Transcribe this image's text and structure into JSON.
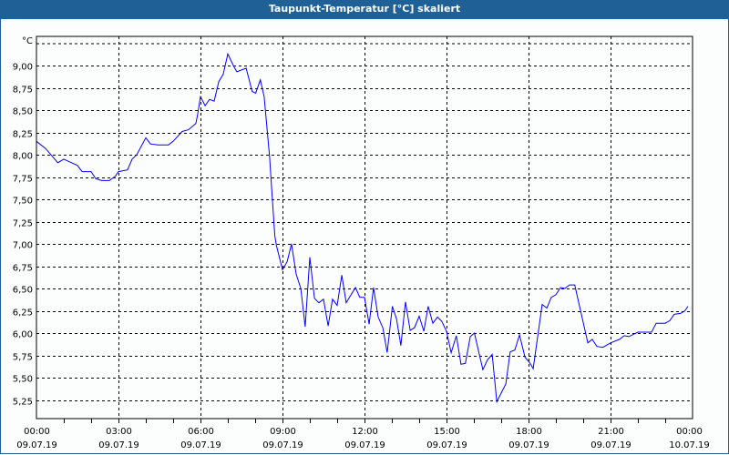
{
  "window": {
    "title": "Taupunkt-Temperatur [°C] skaliert"
  },
  "chart_data": {
    "type": "line",
    "title": "Taupunkt-Temperatur [°C] skaliert",
    "ylabel": "°C",
    "xlabel": "",
    "ylim": [
      5.0,
      9.32
    ],
    "xlim_hours": [
      0,
      24
    ],
    "grid": true,
    "yticks": [
      {
        "value": 9.0,
        "label": "9,00"
      },
      {
        "value": 8.75,
        "label": "8,75"
      },
      {
        "value": 8.5,
        "label": "8,50"
      },
      {
        "value": 8.25,
        "label": "8,25"
      },
      {
        "value": 8.0,
        "label": "8,00"
      },
      {
        "value": 7.75,
        "label": "7,75"
      },
      {
        "value": 7.5,
        "label": "7,50"
      },
      {
        "value": 7.25,
        "label": "7,25"
      },
      {
        "value": 7.0,
        "label": "7,00"
      },
      {
        "value": 6.75,
        "label": "6,75"
      },
      {
        "value": 6.5,
        "label": "6,50"
      },
      {
        "value": 6.25,
        "label": "6,25"
      },
      {
        "value": 6.0,
        "label": "6,00"
      },
      {
        "value": 5.75,
        "label": "5,75"
      },
      {
        "value": 5.5,
        "label": "5,50"
      },
      {
        "value": 5.25,
        "label": "5,25"
      }
    ],
    "xticks": [
      {
        "hour": 0,
        "time": "00:00",
        "date": "09.07.19"
      },
      {
        "hour": 3,
        "time": "03:00",
        "date": "09.07.19"
      },
      {
        "hour": 6,
        "time": "06:00",
        "date": "09.07.19"
      },
      {
        "hour": 9,
        "time": "09:00",
        "date": "09.07.19"
      },
      {
        "hour": 12,
        "time": "12:00",
        "date": "09.07.19"
      },
      {
        "hour": 15,
        "time": "15:00",
        "date": "09.07.19"
      },
      {
        "hour": 18,
        "time": "18:00",
        "date": "09.07.19"
      },
      {
        "hour": 21,
        "time": "21:00",
        "date": "09.07.19"
      },
      {
        "hour": 24,
        "time": "00:00",
        "date": "10.07.19"
      }
    ],
    "series": [
      {
        "name": "Taupunkt-Temperatur",
        "color": "#0000ff",
        "x_hours": [
          0,
          0.33,
          0.67,
          0.78,
          1.0,
          1.28,
          1.5,
          1.67,
          2.0,
          2.17,
          2.39,
          2.67,
          2.89,
          3.0,
          3.33,
          3.5,
          3.67,
          4.0,
          4.17,
          4.44,
          4.83,
          5.0,
          5.33,
          5.56,
          5.83,
          5.89,
          6.0,
          6.17,
          6.33,
          6.5,
          6.67,
          6.83,
          7.0,
          7.22,
          7.33,
          7.67,
          7.89,
          8.02,
          8.19,
          8.33,
          8.53,
          8.61,
          8.72,
          8.78,
          9.0,
          9.17,
          9.33,
          9.5,
          9.67,
          9.83,
          10.0,
          10.17,
          10.33,
          10.5,
          10.67,
          10.83,
          11.0,
          11.17,
          11.33,
          11.67,
          11.83,
          12.0,
          12.17,
          12.33,
          12.5,
          12.67,
          12.83,
          13.02,
          13.17,
          13.33,
          13.5,
          13.67,
          13.83,
          14.0,
          14.17,
          14.33,
          14.5,
          14.67,
          14.83,
          15.0,
          15.17,
          15.36,
          15.53,
          15.69,
          15.87,
          16.02,
          16.33,
          16.5,
          16.67,
          16.84,
          17.17,
          17.33,
          17.5,
          17.67,
          17.87,
          18.06,
          18.17,
          18.5,
          18.67,
          18.83,
          19.0,
          19.17,
          19.33,
          19.5,
          19.69,
          20.17,
          20.33,
          20.5,
          20.72,
          21.0,
          21.33,
          21.5,
          21.67,
          22.0,
          22.5,
          22.67,
          23.0,
          23.17,
          23.33,
          23.56,
          23.72,
          23.83
        ],
        "values": [
          8.15,
          8.07,
          7.95,
          7.91,
          7.95,
          7.91,
          7.88,
          7.81,
          7.81,
          7.73,
          7.71,
          7.71,
          7.76,
          7.81,
          7.83,
          7.95,
          8.0,
          8.19,
          8.12,
          8.11,
          8.11,
          8.15,
          8.26,
          8.28,
          8.35,
          8.44,
          8.65,
          8.55,
          8.62,
          8.6,
          8.82,
          8.9,
          9.13,
          8.99,
          8.93,
          8.97,
          8.71,
          8.69,
          8.84,
          8.65,
          7.97,
          7.59,
          7.09,
          6.98,
          6.71,
          6.8,
          7.0,
          6.66,
          6.5,
          6.07,
          6.85,
          6.39,
          6.34,
          6.38,
          6.08,
          6.38,
          6.31,
          6.65,
          6.34,
          6.51,
          6.4,
          6.4,
          6.1,
          6.51,
          6.18,
          6.06,
          5.78,
          6.3,
          6.16,
          5.86,
          6.35,
          6.03,
          6.06,
          6.19,
          6.02,
          6.3,
          6.11,
          6.18,
          6.13,
          6.02,
          5.78,
          5.97,
          5.65,
          5.66,
          5.96,
          6.0,
          5.59,
          5.7,
          5.76,
          5.23,
          5.43,
          5.79,
          5.81,
          5.98,
          5.73,
          5.66,
          5.6,
          6.32,
          6.28,
          6.4,
          6.43,
          6.51,
          6.5,
          6.54,
          6.54,
          5.89,
          5.93,
          5.85,
          5.84,
          5.89,
          5.93,
          5.97,
          5.96,
          6.01,
          6.01,
          6.11,
          6.11,
          6.14,
          6.21,
          6.22,
          6.25,
          6.3
        ]
      }
    ]
  }
}
